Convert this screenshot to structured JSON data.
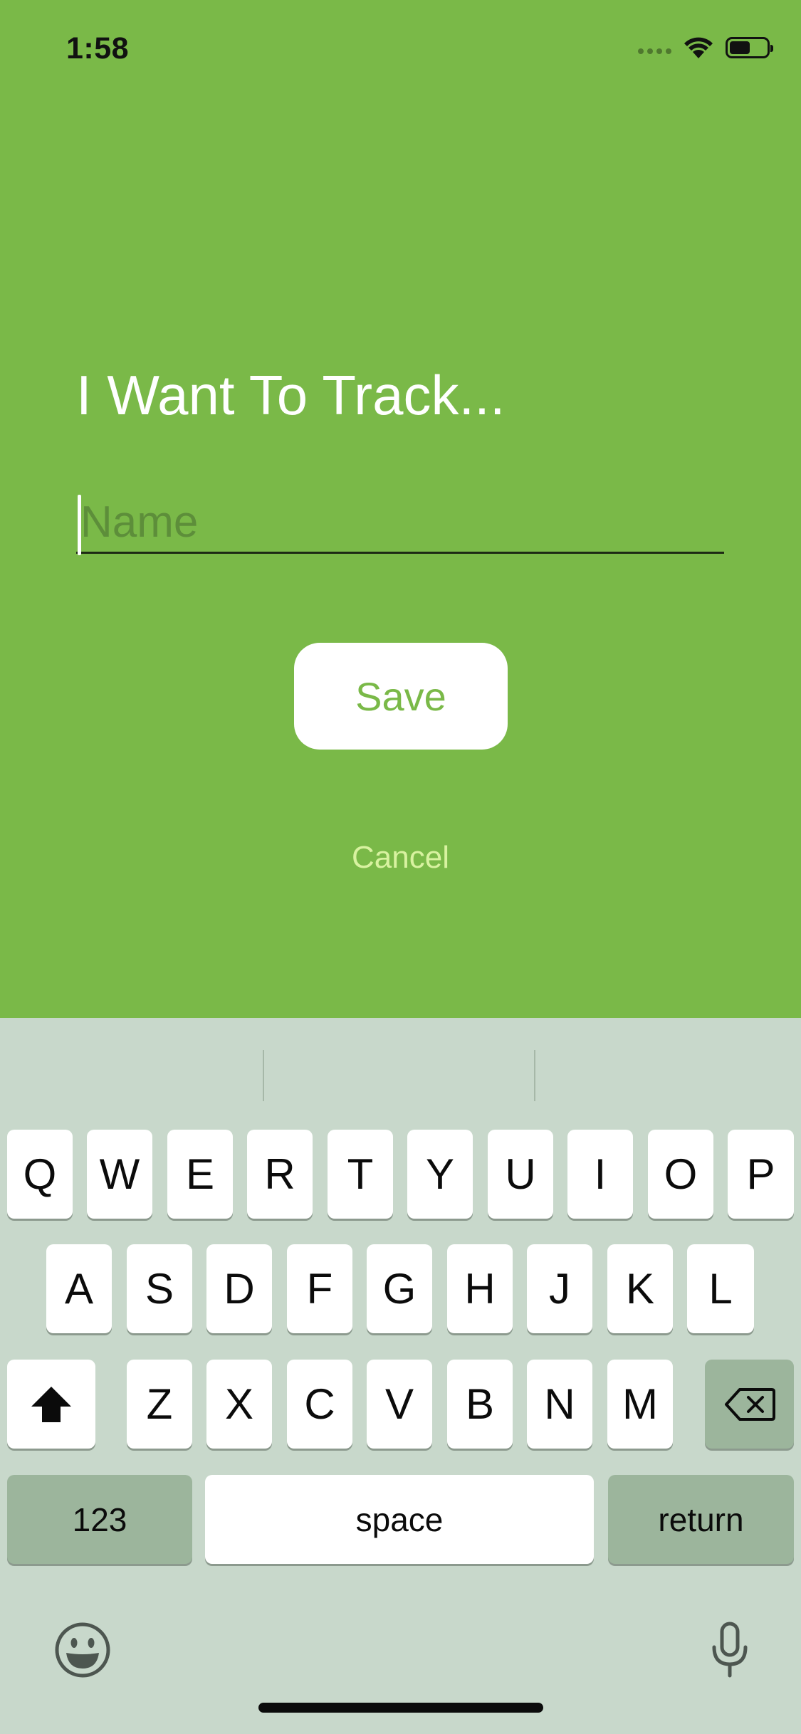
{
  "status_bar": {
    "time": "1:58"
  },
  "form": {
    "heading": "I Want To Track...",
    "name_placeholder": "Name",
    "save_label": "Save",
    "cancel_label": "Cancel"
  },
  "keyboard": {
    "row1": [
      "Q",
      "W",
      "E",
      "R",
      "T",
      "Y",
      "U",
      "I",
      "O",
      "P"
    ],
    "row2": [
      "A",
      "S",
      "D",
      "F",
      "G",
      "H",
      "J",
      "K",
      "L"
    ],
    "row3": [
      "Z",
      "X",
      "C",
      "V",
      "B",
      "N",
      "M"
    ],
    "numbers_label": "123",
    "space_label": "space",
    "return_label": "return"
  },
  "colors": {
    "background": "#7ab948",
    "cancel_text": "#d8f2a0",
    "keyboard_bg": "#c8d8cb",
    "key_dark": "#9cb59c"
  },
  "icons": {
    "signal": "cellular-signal-icon",
    "wifi": "wifi-icon",
    "battery": "battery-icon",
    "shift": "shift-icon",
    "delete": "delete-icon",
    "emoji": "emoji-icon",
    "mic": "microphone-icon"
  }
}
